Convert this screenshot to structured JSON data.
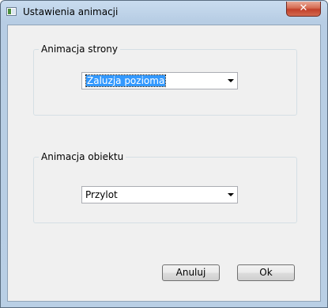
{
  "window": {
    "title": "Ustawienia animacji",
    "close_symbol": "✕"
  },
  "page_animation": {
    "label": "Animacja strony",
    "selected": "Żaluzja pozioma"
  },
  "object_animation": {
    "label": "Animacja obiektu",
    "selected": "Przylot"
  },
  "buttons": {
    "cancel": "Anuluj",
    "ok": "Ok"
  },
  "icons": {
    "app": "app-window-icon",
    "close": "close-icon",
    "dropdown": "chevron-down-icon"
  }
}
